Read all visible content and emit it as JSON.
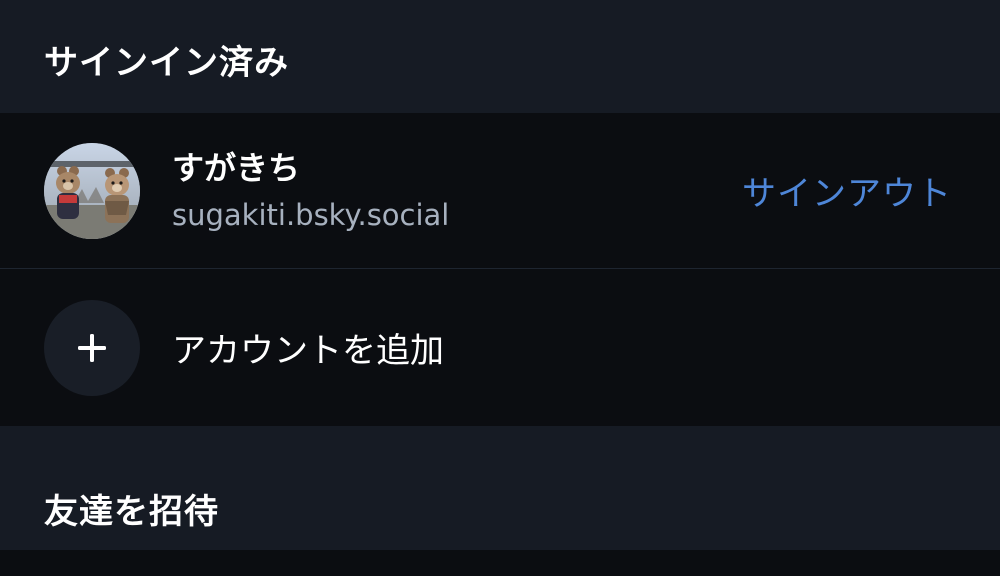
{
  "signed_in_section": {
    "title": "サインイン済み"
  },
  "account": {
    "display_name": "すがきち",
    "handle": "sugakiti.bsky.social",
    "signout_label": "サインアウト",
    "avatar_icon": "profile-photo-two-teddy-bears"
  },
  "add_account": {
    "label": "アカウントを追加",
    "icon": "plus-icon"
  },
  "invite_section": {
    "title": "友達を招待"
  },
  "colors": {
    "background": "#161b24",
    "row_background": "#0b0d11",
    "accent": "#4e86d8",
    "secondary_text": "#a7b1bf"
  }
}
